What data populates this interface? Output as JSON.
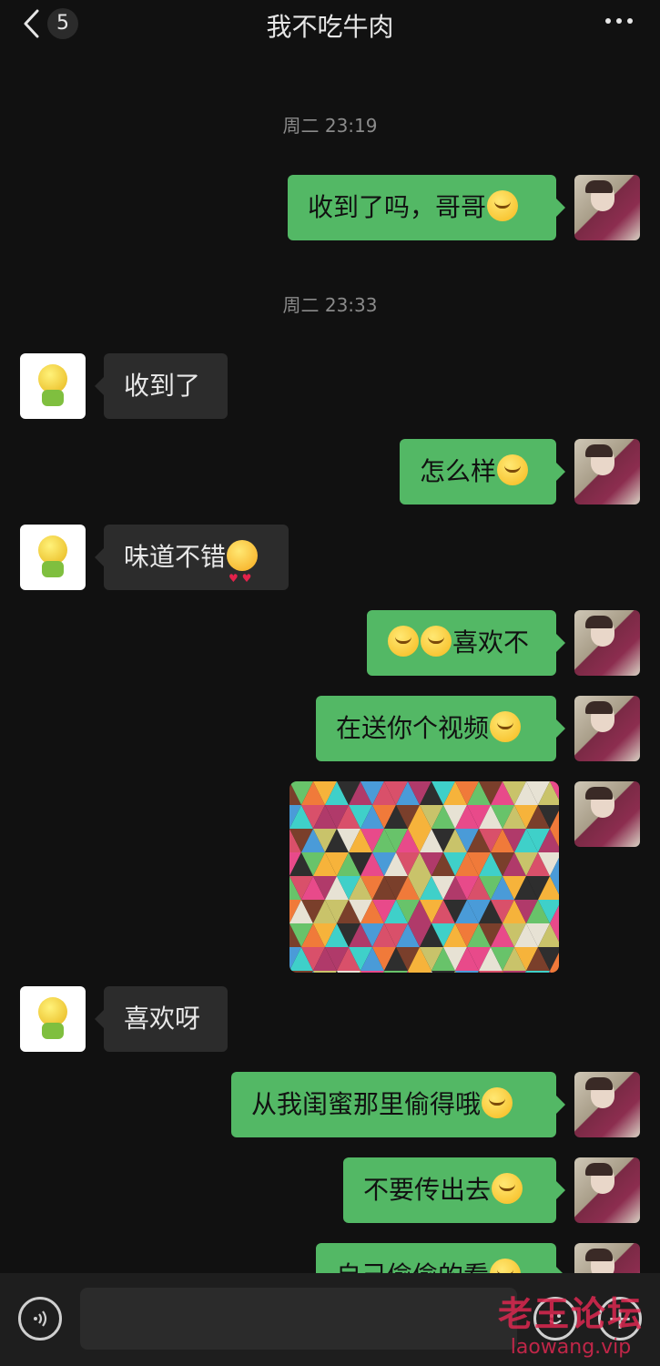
{
  "header": {
    "unread_count": "5",
    "title": "我不吃牛肉"
  },
  "timestamps": [
    "周二 23:19",
    "周二 23:33"
  ],
  "messages": [
    {
      "side": "me",
      "text": "收到了吗，哥哥",
      "emoji": "smile-emoji"
    },
    {
      "side": "them",
      "text": "收到了"
    },
    {
      "side": "me",
      "text": "怎么样",
      "emoji": "smile-emoji"
    },
    {
      "side": "them",
      "text": "味道不错",
      "emoji": "heart-eyes-emoji"
    },
    {
      "side": "me",
      "text": "喜欢不",
      "emoji_prefix": [
        "thinking-emoji",
        "thinking-emoji"
      ]
    },
    {
      "side": "me",
      "text": "在送你个视频",
      "emoji": "thinking-emoji"
    },
    {
      "side": "me",
      "type": "image",
      "description_icon": "mosaic-image"
    },
    {
      "side": "them",
      "text": "喜欢呀"
    },
    {
      "side": "me",
      "text": "从我闺蜜那里偷得哦",
      "emoji": "grin-emoji"
    },
    {
      "side": "me",
      "text": "不要传出去",
      "emoji": "thinking-emoji"
    },
    {
      "side": "me",
      "text": "自己偷偷的看",
      "emoji": "smile-emoji"
    }
  ],
  "input_bar": {
    "text_value": "",
    "icons": [
      "voice-icon",
      "emoji-icon",
      "plus-icon"
    ]
  },
  "watermark": {
    "line1": "老王论坛",
    "line2": "laowang.vip"
  },
  "colors": {
    "background": "#111111",
    "my_bubble": "#53b865",
    "their_bubble": "#2c2c2c"
  }
}
